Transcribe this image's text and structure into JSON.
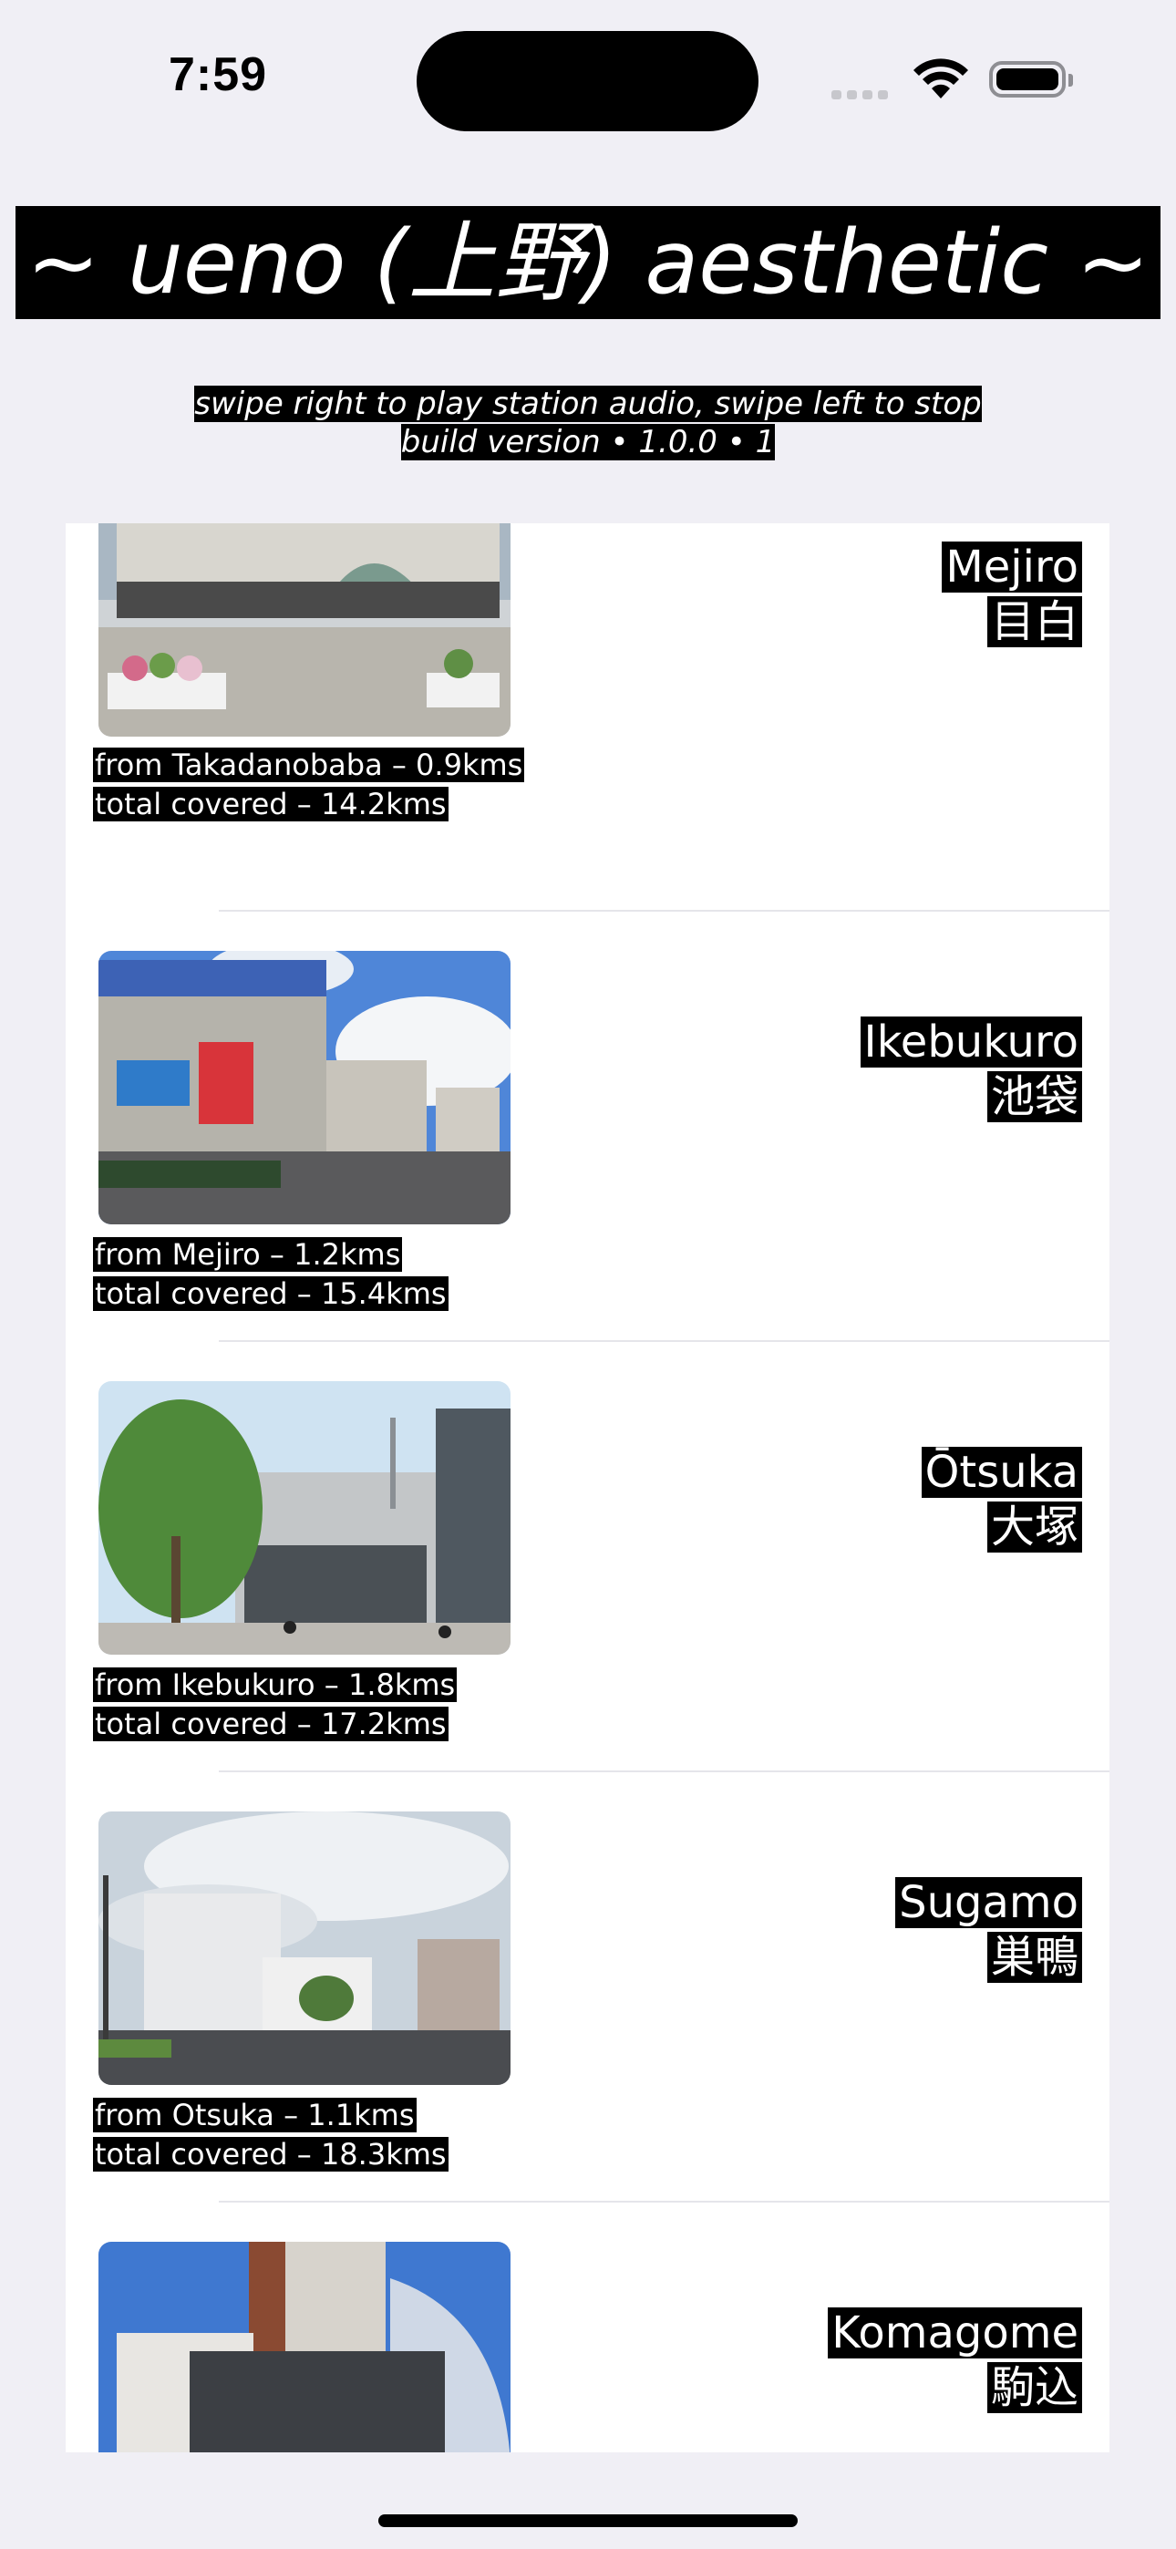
{
  "status": {
    "time": "7:59"
  },
  "header": {
    "title": "~ ueno (上野) aesthetic ~",
    "subtitle_line1": "swipe right to play station audio, swipe left to stop",
    "subtitle_line2": "build version • 1.0.0 • 1"
  },
  "stations": [
    {
      "name_en": "Mejiro",
      "name_jp": "目白",
      "from": "from Takadanobaba – 0.9kms",
      "total": "total covered – 14.2kms",
      "photo": "mejiro-station-photo"
    },
    {
      "name_en": "Ikebukuro",
      "name_jp": "池袋",
      "from": "from Mejiro – 1.2kms",
      "total": "total covered – 15.4kms",
      "photo": "ikebukuro-station-photo"
    },
    {
      "name_en": "Ōtsuka",
      "name_jp": "大塚",
      "from": "from Ikebukuro – 1.8kms",
      "total": "total covered – 17.2kms",
      "photo": "otsuka-station-photo"
    },
    {
      "name_en": "Sugamo",
      "name_jp": "巣鴨",
      "from": "from Otsuka – 1.1kms",
      "total": "total covered – 18.3kms",
      "photo": "sugamo-station-photo"
    },
    {
      "name_en": "Komagome",
      "name_jp": "駒込",
      "from": "",
      "total": "",
      "photo": "komagome-station-photo"
    }
  ]
}
